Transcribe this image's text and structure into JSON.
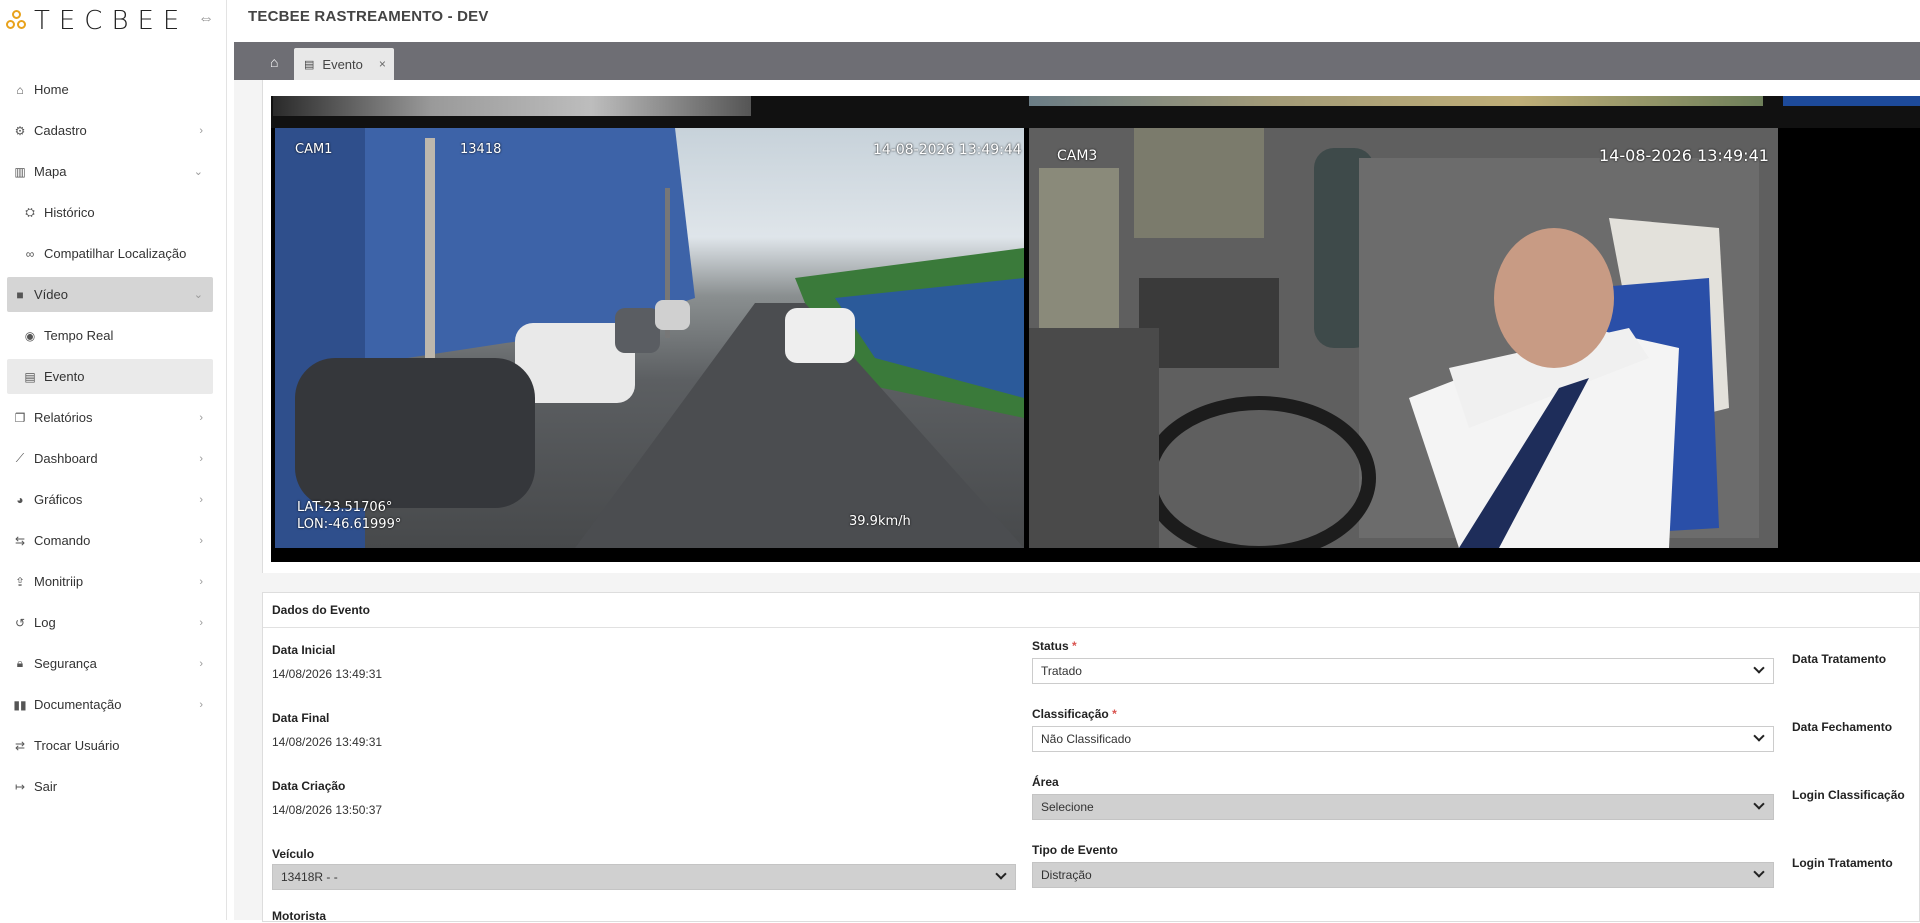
{
  "brand": {
    "name": "TECBEE"
  },
  "sidebar": {
    "items": [
      {
        "label": "Home",
        "icon": "home-icon",
        "glyph": "⌂",
        "chevron": ""
      },
      {
        "label": "Cadastro",
        "icon": "gear-icon",
        "glyph": "⚙",
        "chevron": "›"
      },
      {
        "label": "Mapa",
        "icon": "map-icon",
        "glyph": "▥",
        "chevron": "⌄"
      },
      {
        "label": "Histórico",
        "icon": "history-icon",
        "glyph": "⛭",
        "chevron": ""
      },
      {
        "label": "Compatilhar Localização",
        "icon": "link-icon",
        "glyph": "∞",
        "chevron": ""
      },
      {
        "label": "Vídeo",
        "icon": "video-icon",
        "glyph": "■",
        "chevron": "⌄"
      },
      {
        "label": "Tempo Real",
        "icon": "eye-icon",
        "glyph": "◉",
        "chevron": ""
      },
      {
        "label": "Evento",
        "icon": "document-icon",
        "glyph": "▤",
        "chevron": ""
      },
      {
        "label": "Relatórios",
        "icon": "copy-icon",
        "glyph": "❐",
        "chevron": "›"
      },
      {
        "label": "Dashboard",
        "icon": "line-chart-icon",
        "glyph": "⟋",
        "chevron": "›"
      },
      {
        "label": "Gráficos",
        "icon": "palette-icon",
        "glyph": "◕",
        "chevron": "›"
      },
      {
        "label": "Comando",
        "icon": "exchange-icon",
        "glyph": "⇆",
        "chevron": "›"
      },
      {
        "label": "Monitriip",
        "icon": "share-icon",
        "glyph": "⇪",
        "chevron": "›"
      },
      {
        "label": "Log",
        "icon": "history-back-icon",
        "glyph": "↺",
        "chevron": "›"
      },
      {
        "label": "Segurança",
        "icon": "lock-icon",
        "glyph": "🔒︎",
        "chevron": "›"
      },
      {
        "label": "Documentação",
        "icon": "book-icon",
        "glyph": "▮▮",
        "chevron": "›"
      },
      {
        "label": "Trocar Usuário",
        "icon": "swap-icon",
        "glyph": "⇄",
        "chevron": ""
      },
      {
        "label": "Sair",
        "icon": "sign-out-icon",
        "glyph": "↦",
        "chevron": ""
      }
    ]
  },
  "header": {
    "title": "TECBEE RASTREAMENTO - DEV"
  },
  "tabs": {
    "home_glyph": "⌂",
    "active": {
      "label": "Evento",
      "close": "×"
    }
  },
  "video": {
    "left": {
      "cam": "CAM1",
      "id": "13418",
      "timestamp": "14-08-2026 13:49:44",
      "lat": "LAT-23.51706°",
      "lon": "LON:-46.61999°",
      "speed": "39.9km/h"
    },
    "right": {
      "cam": "CAM3",
      "timestamp": "14-08-2026 13:49:41"
    }
  },
  "form": {
    "title": "Dados do Evento",
    "data_inicial": {
      "label": "Data Inicial",
      "value": "14/08/2026 13:49:31"
    },
    "data_final": {
      "label": "Data Final",
      "value": "14/08/2026 13:49:31"
    },
    "data_criacao": {
      "label": "Data Criação",
      "value": "14/08/2026 13:50:37"
    },
    "veiculo": {
      "label": "Veículo",
      "value": "13418R - -"
    },
    "motorista": {
      "label": "Motorista"
    },
    "status": {
      "label": "Status",
      "required": "*",
      "value": "Tratado"
    },
    "classificacao": {
      "label": "Classificação",
      "required": "*",
      "value": "Não Classificado"
    },
    "area": {
      "label": "Área",
      "value": "Selecione"
    },
    "tipo_evento": {
      "label": "Tipo de Evento",
      "value": "Distração"
    },
    "data_tratamento": {
      "label": "Data Tratamento"
    },
    "data_fechamento": {
      "label": "Data Fechamento"
    },
    "login_classificacao": {
      "label": "Login Classificação"
    },
    "login_tratamento": {
      "label": "Login Tratamento"
    }
  }
}
